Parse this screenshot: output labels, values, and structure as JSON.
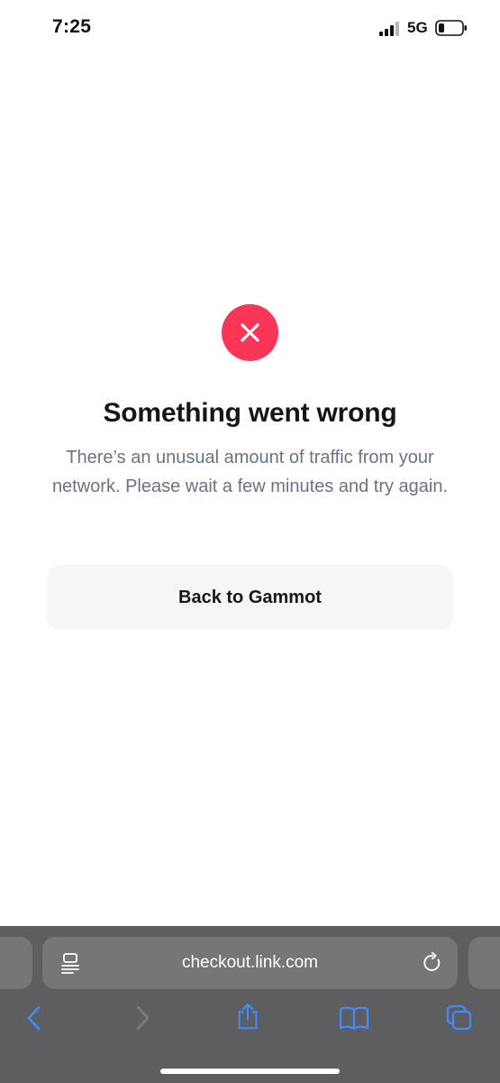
{
  "status_bar": {
    "time": "7:25",
    "network": "5G"
  },
  "error": {
    "icon": "close-icon",
    "icon_color": "#fa3556",
    "title": "Something went wrong",
    "message": "There’s an unusual amount of traffic from your network. Please wait a few minutes and try again."
  },
  "actions": {
    "back_label": "Back to Gammot"
  },
  "browser": {
    "url": "checkout.link.com",
    "toolbar_icons": [
      "back-arrow-icon",
      "forward-arrow-icon",
      "share-icon",
      "bookmarks-icon",
      "tabs-icon"
    ],
    "accent": "#3f8cff"
  }
}
